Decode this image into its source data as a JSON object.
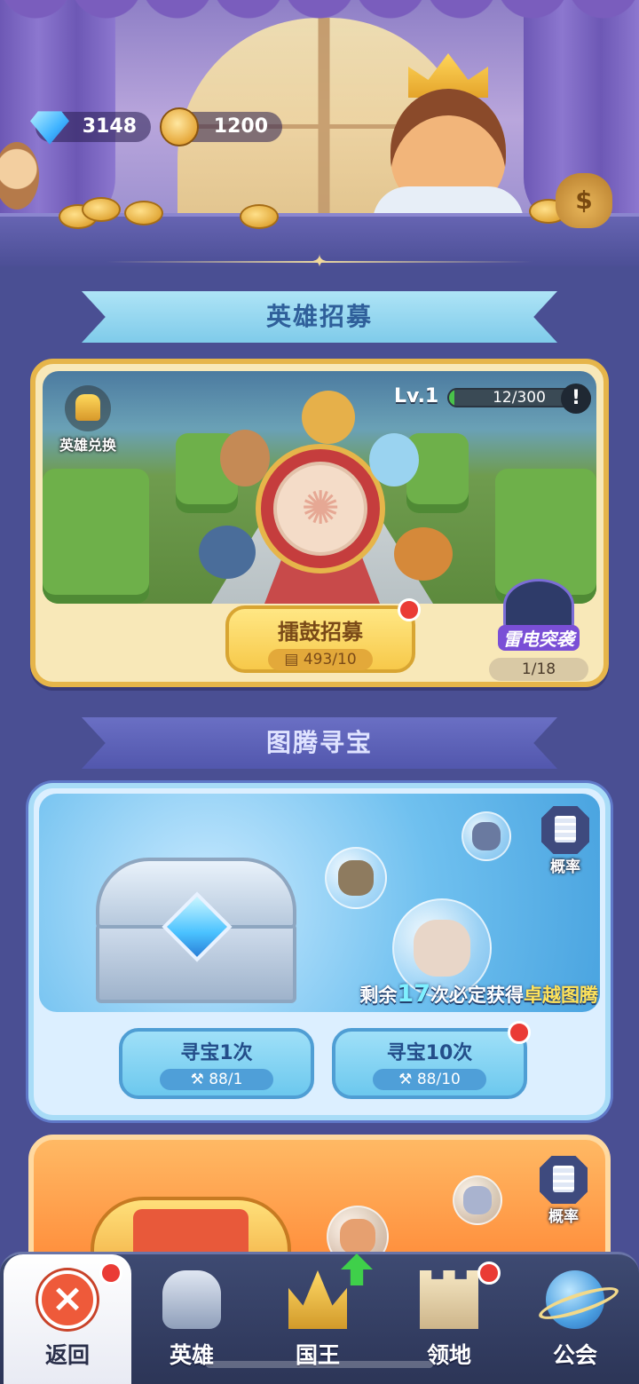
{
  "currency": {
    "gems": "3148",
    "gold": "1200"
  },
  "recruit": {
    "title": "英雄招募",
    "exchange_label": "英雄兑换",
    "level_label": "Lv.1",
    "level_progress_text": "12/300",
    "level_progress_fraction": 0.04,
    "info_icon": "!",
    "drum_button_label": "擂鼓招募",
    "drum_button_cost": "493/10",
    "event_name": "雷电突袭",
    "event_progress": "1/18"
  },
  "treasure": {
    "title": "图腾寻宝",
    "rate_label": "概率",
    "guarantee_prefix": "剩余",
    "guarantee_count": "17",
    "guarantee_mid": "次必定获得",
    "guarantee_item": "卓越图腾",
    "seek1_label": "寻宝1次",
    "seek1_cost": "88/1",
    "seek10_label": "寻宝10次",
    "seek10_cost": "88/10"
  },
  "orange": {
    "rate_label": "概率"
  },
  "nav": {
    "items": [
      {
        "label": "返回",
        "icon": "close-icon"
      },
      {
        "label": "英雄",
        "icon": "helmet-icon"
      },
      {
        "label": "国王",
        "icon": "crown-icon"
      },
      {
        "label": "领地",
        "icon": "castle-icon"
      },
      {
        "label": "公会",
        "icon": "planet-icon"
      }
    ]
  },
  "colors": {
    "background": "#4a4f93",
    "gold_accent": "#e6b54a",
    "sky_accent": "#a8dcf7",
    "notification": "#ea3b35"
  }
}
